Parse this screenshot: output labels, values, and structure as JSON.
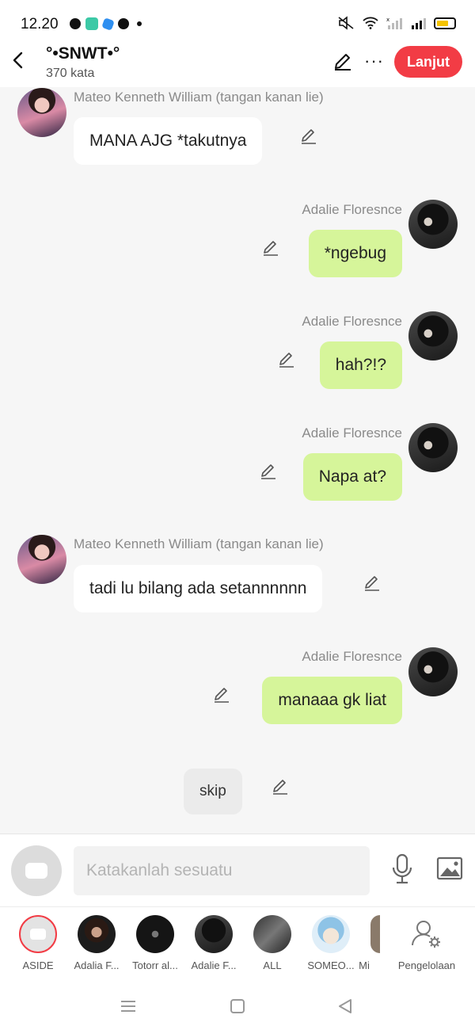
{
  "status_bar": {
    "time": "12.20",
    "battery_level": 0.7,
    "battery_color": "#f5c400"
  },
  "header": {
    "title": "°•SNWT•°",
    "word_count": "370 kata",
    "next_button": "Lanjut",
    "accent_color": "#f23c45"
  },
  "messages": [
    {
      "sender": "Mateo Kenneth William (tangan kanan lie)",
      "side": "left",
      "text": "MANA AJG *takutnya"
    },
    {
      "sender": "Adalie Floresnce",
      "side": "right",
      "text": "*ngebug"
    },
    {
      "sender": "Adalie Floresnce",
      "side": "right",
      "text": "hah?!?"
    },
    {
      "sender": "Adalie Floresnce",
      "side": "right",
      "text": "Napa at?"
    },
    {
      "sender": "Mateo Kenneth William (tangan kanan lie)",
      "side": "left",
      "text": "tadi lu bilang ada setannnnnn"
    },
    {
      "sender": "Adalie Floresnce",
      "side": "right",
      "text": "manaaa gk liat"
    },
    {
      "sender": "",
      "side": "center",
      "text": "skip"
    }
  ],
  "composer": {
    "placeholder": "Katakanlah sesuatu"
  },
  "characters": [
    {
      "label": "ASIDE"
    },
    {
      "label": "Adalia F..."
    },
    {
      "label": "Totorr al..."
    },
    {
      "label": "Adalie F..."
    },
    {
      "label": "ALL"
    },
    {
      "label": "SOMEO..."
    },
    {
      "label": "Mi"
    },
    {
      "label": "Pengelolaan"
    }
  ],
  "colors": {
    "own_bubble": "#d6f59a",
    "other_bubble": "#ffffff",
    "background": "#f6f6f6"
  }
}
